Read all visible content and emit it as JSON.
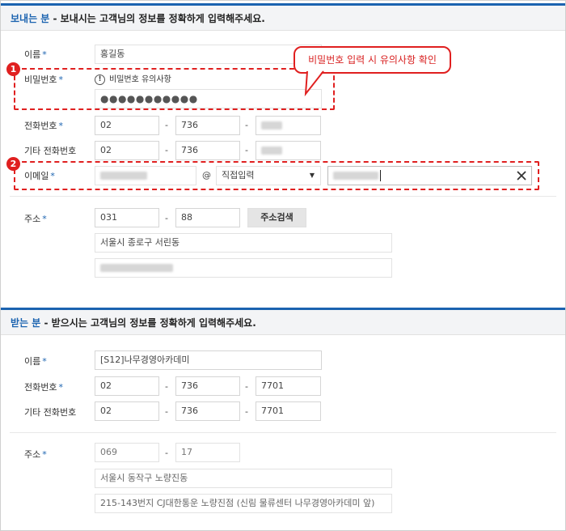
{
  "sender": {
    "heading_who": "보내는 분",
    "heading_desc": " - 보내시는 고객님의 정보를 정확하게 입력해주세요.",
    "name_label": "이름",
    "name_value": "홍길동",
    "password_label": "비밀번호",
    "password_notice": "비밀번호 유의사항",
    "password_dots": "●●●●●●●●●●●",
    "phone_label": "전화번호",
    "phone": [
      "02",
      "736",
      ""
    ],
    "alt_phone_label": "기타 전화번호",
    "alt_phone": [
      "02",
      "736",
      ""
    ],
    "email_label": "이메일",
    "email_at": "@",
    "email_domain_select": "직접입력",
    "address_label": "주소",
    "zip": [
      "031",
      "88"
    ],
    "address_search_label": "주소검색",
    "address_line1": "서울시 종로구 서린동"
  },
  "receiver": {
    "heading_who": "받는 분",
    "heading_desc": " - 받으시는 고객님의 정보를 정확하게 입력해주세요.",
    "name_label": "이름",
    "name_value": "[S12]나무경영아카데미",
    "phone_label": "전화번호",
    "phone": [
      "02",
      "736",
      "7701"
    ],
    "alt_phone_label": "기타 전화번호",
    "alt_phone": [
      "02",
      "736",
      "7701"
    ],
    "address_label": "주소",
    "zip": [
      "069",
      "17"
    ],
    "address_line1": "서울시 동작구 노량진동",
    "address_line2": "215-143번지 CJ대한통운 노량진점 (신림 물류센터 나무경영아카데미 앞)"
  },
  "annotations": {
    "badge1": "1",
    "badge2": "2",
    "callout": "비밀번호 입력 시 유의사항 확인"
  },
  "common": {
    "required_mark": "*",
    "dash": "-"
  },
  "colors": {
    "accent": "#1b63b0",
    "highlight_red": "#e02020"
  },
  "icons": {
    "notice": "exclamation-circle-icon",
    "clear": "close-icon",
    "dropdown": "caret-down-icon"
  }
}
